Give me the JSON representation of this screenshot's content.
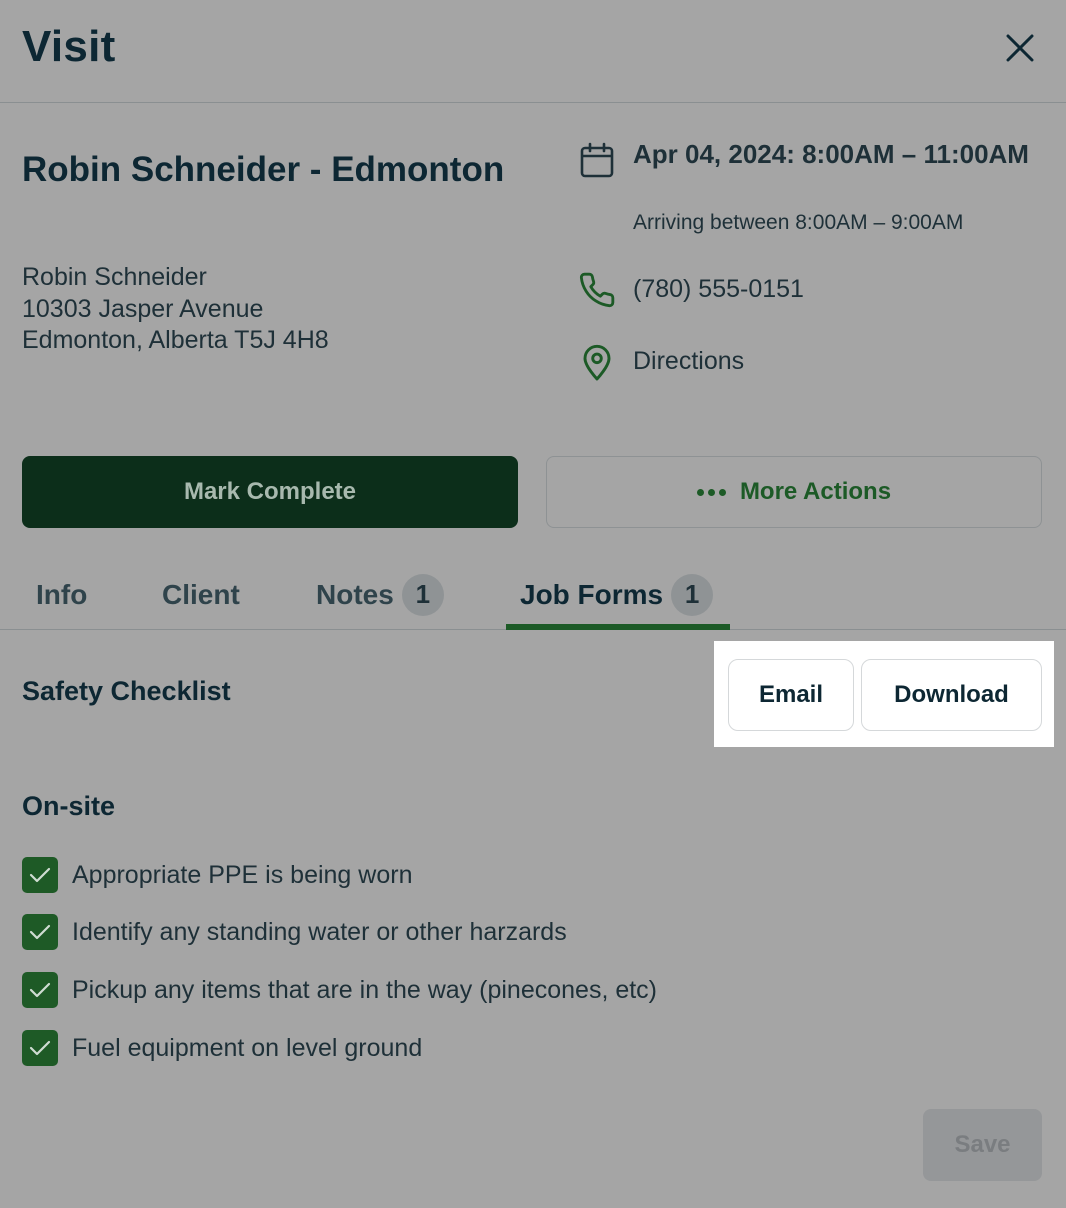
{
  "header": {
    "title": "Visit"
  },
  "visit": {
    "title": "Robin Schneider - Edmonton",
    "client_name": "Robin Schneider",
    "address_line1": "10303 Jasper Avenue",
    "address_line2": "Edmonton, Alberta T5J 4H8",
    "date_range": "Apr 04, 2024: 8:00AM – 11:00AM",
    "arrival_window": "Arriving between 8:00AM – 9:00AM",
    "phone": "(780) 555-0151",
    "directions_label": "Directions"
  },
  "actions": {
    "mark_complete": "Mark Complete",
    "more_actions": "More Actions"
  },
  "tabs": [
    {
      "label": "Info",
      "badge": null,
      "active": false
    },
    {
      "label": "Client",
      "badge": null,
      "active": false
    },
    {
      "label": "Notes",
      "badge": "1",
      "active": false
    },
    {
      "label": "Job Forms",
      "badge": "1",
      "active": true
    }
  ],
  "form": {
    "title": "Safety Checklist",
    "email_label": "Email",
    "download_label": "Download",
    "group_title": "On-site",
    "items": [
      {
        "label": "Appropriate PPE is being worn",
        "checked": true
      },
      {
        "label": "Identify any standing water or other harzards",
        "checked": true
      },
      {
        "label": "Pickup any items that are in the way (pinecones, etc)",
        "checked": true
      },
      {
        "label": "Fuel equipment on level ground",
        "checked": true
      }
    ],
    "save_label": "Save"
  },
  "colors": {
    "overlay_background": "#a5a5a5",
    "primary_dark_green": "#0c2e1a",
    "accent_green": "#1c5a26",
    "text_dark": "#0d2733"
  },
  "icons": {
    "close": "close-icon",
    "calendar": "calendar-icon",
    "phone": "phone-icon",
    "directions": "map-pin-icon",
    "more": "more-dots-icon",
    "checkbox": "checkmark-icon"
  }
}
